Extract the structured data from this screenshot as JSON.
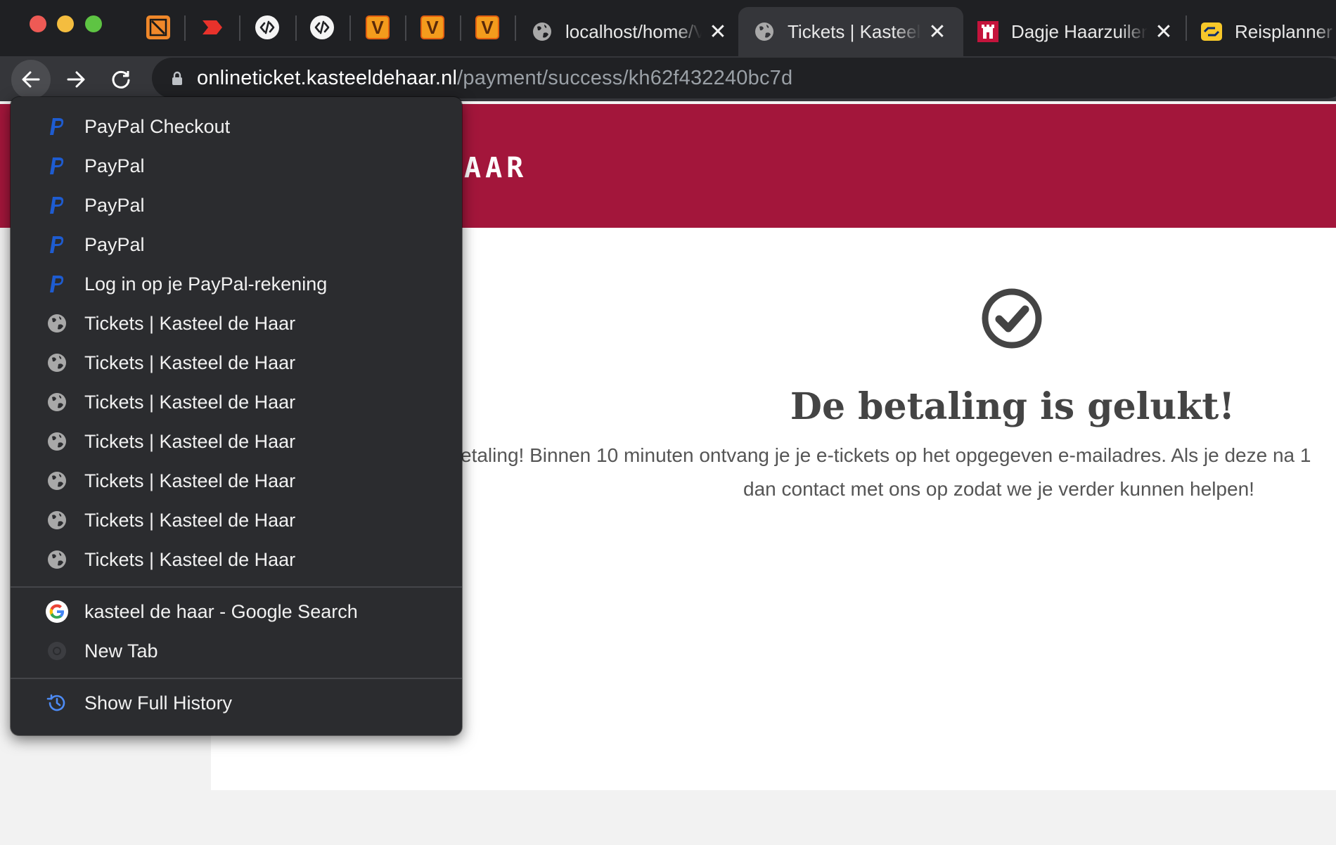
{
  "tabs": {
    "pinned_tabs": [
      {
        "icon": "brush-icon"
      },
      {
        "icon": "red-arrow-icon"
      },
      {
        "icon": "code-icon"
      },
      {
        "icon": "code-icon"
      },
      {
        "icon": "v-logo-icon",
        "label": "V"
      },
      {
        "icon": "v-logo-icon",
        "label": "V"
      },
      {
        "icon": "v-logo-icon",
        "label": "V"
      }
    ],
    "open_tabs": [
      {
        "title": "localhost/home/V",
        "close": "✕",
        "icon": "globe-icon"
      },
      {
        "title": "Tickets | Kasteel",
        "close": "✕",
        "icon": "globe-icon",
        "active": true
      },
      {
        "title": "Dagje Haarzuilen",
        "close": "✕",
        "icon": "castle-icon"
      },
      {
        "title": "Reisplanner",
        "icon": "ns-logo-icon"
      }
    ]
  },
  "toolbar": {
    "url_host": "onlineticket.kasteeldehaar.nl",
    "url_path": "/payment/success/kh62f432240bc7d"
  },
  "page": {
    "logo_text": "AAR",
    "success_title": "De betaling is gelukt!",
    "success_line1": "etaling! Binnen 10 minuten ontvang je je e-tickets op het opgegeven e-mailadres. Als je deze na 1",
    "success_line2": "dan contact met ons op zodat we je verder kunnen helpen!",
    "colors": {
      "banner": "#a3163b",
      "page_bg": "#f2f2f2"
    }
  },
  "history_menu": {
    "entries": [
      {
        "label": "PayPal Checkout",
        "icon": "paypal-icon"
      },
      {
        "label": "PayPal",
        "icon": "paypal-icon"
      },
      {
        "label": "PayPal",
        "icon": "paypal-icon"
      },
      {
        "label": "PayPal",
        "icon": "paypal-icon"
      },
      {
        "label": "Log in op je PayPal-rekening",
        "icon": "paypal-icon"
      },
      {
        "label": "Tickets | Kasteel de Haar",
        "icon": "globe-icon"
      },
      {
        "label": "Tickets | Kasteel de Haar",
        "icon": "globe-icon"
      },
      {
        "label": "Tickets | Kasteel de Haar",
        "icon": "globe-icon"
      },
      {
        "label": "Tickets | Kasteel de Haar",
        "icon": "globe-icon"
      },
      {
        "label": "Tickets | Kasteel de Haar",
        "icon": "globe-icon"
      },
      {
        "label": "Tickets | Kasteel de Haar",
        "icon": "globe-icon"
      },
      {
        "label": "Tickets | Kasteel de Haar",
        "icon": "globe-icon"
      }
    ],
    "other_entries": [
      {
        "label": "kasteel de haar - Google Search",
        "icon": "google-icon"
      },
      {
        "label": "New Tab",
        "icon": "chrome-icon"
      }
    ],
    "show_full_history": {
      "label": "Show Full History",
      "icon": "history-icon"
    }
  }
}
